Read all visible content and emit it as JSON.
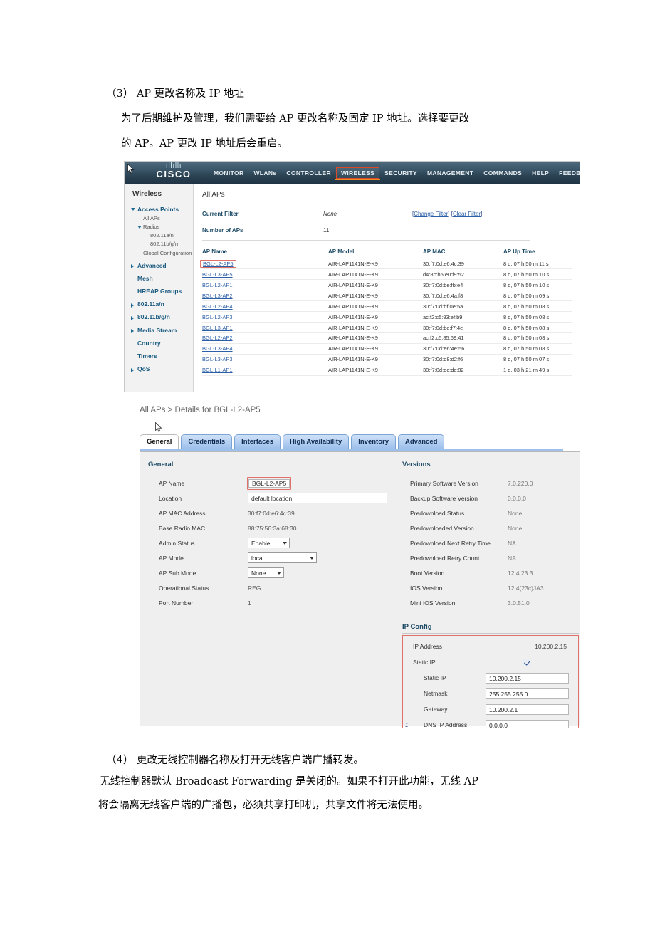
{
  "document": {
    "para3_heading": "（3） AP 更改名称及 IP 地址",
    "para3_line1": "为了后期维护及管理，我们需要给 AP 更改名称及固定 IP 地址。选择要更改",
    "para3_line2": "的 AP。AP 更改 IP 地址后会重启。",
    "para4_heading": "（4） 更改无线控制器名称及打开无线客户端广播转发。",
    "para4_line1": "无线控制器默认 Broadcast Forwarding  是关闭的。如果不打开此功能，无线 AP",
    "para4_line2": "将会隔离无线客户端的广播包，必须共享打印机，共享文件将无法使用。"
  },
  "wlc": {
    "brand": "CISCO",
    "brand_bars": "ıllıllı",
    "nav": [
      {
        "label": "MONITOR",
        "active": false
      },
      {
        "label": "WLANs",
        "active": false
      },
      {
        "label": "CONTROLLER",
        "active": false
      },
      {
        "label": "WIRELESS",
        "active": true
      },
      {
        "label": "SECURITY",
        "active": false
      },
      {
        "label": "MANAGEMENT",
        "active": false
      },
      {
        "label": "COMMANDS",
        "active": false
      },
      {
        "label": "HELP",
        "active": false
      },
      {
        "label": "FEEDBACK",
        "active": false
      }
    ],
    "sidebar": {
      "title": "Wireless",
      "items": [
        {
          "label": "Access Points",
          "level": 0,
          "bold": true,
          "arrow": "down"
        },
        {
          "label": "All APs",
          "level": 1,
          "bold": false,
          "arrow": "none"
        },
        {
          "label": "Radios",
          "level": 1,
          "bold": false,
          "arrow": "down"
        },
        {
          "label": "802.11a/n",
          "level": 2,
          "bold": false,
          "arrow": "none"
        },
        {
          "label": "802.11b/g/n",
          "level": 2,
          "bold": false,
          "arrow": "none"
        },
        {
          "label": "Global Configuration",
          "level": 1,
          "bold": false,
          "arrow": "none"
        },
        {
          "label": "Advanced",
          "level": 0,
          "bold": true,
          "arrow": "right"
        },
        {
          "label": "Mesh",
          "level": 0,
          "bold": true,
          "arrow": "none"
        },
        {
          "label": "HREAP Groups",
          "level": 0,
          "bold": true,
          "arrow": "none"
        },
        {
          "label": "802.11a/n",
          "level": 0,
          "bold": true,
          "arrow": "right"
        },
        {
          "label": "802.11b/g/n",
          "level": 0,
          "bold": true,
          "arrow": "right"
        },
        {
          "label": "Media Stream",
          "level": 0,
          "bold": true,
          "arrow": "right"
        },
        {
          "label": "Country",
          "level": 0,
          "bold": true,
          "arrow": "none"
        },
        {
          "label": "Timers",
          "level": 0,
          "bold": true,
          "arrow": "none"
        },
        {
          "label": "QoS",
          "level": 0,
          "bold": true,
          "arrow": "right"
        }
      ]
    },
    "page_title": "All APs",
    "current_filter_label": "Current Filter",
    "current_filter_value": "None",
    "change_filter_link": "Change Filter",
    "clear_filter_link": "Clear Filter",
    "number_of_aps_label": "Number of APs",
    "number_of_aps_value": "11",
    "table": {
      "headers": [
        "AP Name",
        "AP Model",
        "AP MAC",
        "AP Up Time"
      ],
      "rows": [
        {
          "name": "BGL-L2-AP5",
          "model": "AIR-LAP1141N-E-K9",
          "mac": "30:f7:0d:e6:4c:39",
          "uptime": "8 d, 07 h 50 m 11 s",
          "highlight": true
        },
        {
          "name": "BGL-L3-AP5",
          "model": "AIR-LAP1141N-E-K9",
          "mac": "d4:8c:b5:e0:f9:52",
          "uptime": "8 d, 07 h 50 m 10 s",
          "highlight": false
        },
        {
          "name": "BGL-L2-AP1",
          "model": "AIR-LAP1141N-E-K9",
          "mac": "30:f7:0d:be:fb:e4",
          "uptime": "8 d, 07 h 50 m 10 s",
          "highlight": false
        },
        {
          "name": "BGL-L3-AP2",
          "model": "AIR-LAP1141N-E-K9",
          "mac": "30:f7:0d:e6:4a:f8",
          "uptime": "8 d, 07 h 50 m 09 s",
          "highlight": false
        },
        {
          "name": "BGL-L2-AP4",
          "model": "AIR-LAP1141N-E-K9",
          "mac": "30:f7:0d:bf:0e:5a",
          "uptime": "8 d, 07 h 50 m 08 s",
          "highlight": false
        },
        {
          "name": "BGL-L2-AP3",
          "model": "AIR-LAP1141N-E-K9",
          "mac": "ac:f2:c5:93:ef:b9",
          "uptime": "8 d, 07 h 50 m 08 s",
          "highlight": false
        },
        {
          "name": "BGL-L3-AP1",
          "model": "AIR-LAP1141N-E-K9",
          "mac": "30:f7:0d:be:f7:4e",
          "uptime": "8 d, 07 h 50 m 08 s",
          "highlight": false
        },
        {
          "name": "BGL-L2-AP2",
          "model": "AIR-LAP1141N-E-K9",
          "mac": "ac:f2:c5:85:69:41",
          "uptime": "8 d, 07 h 50 m 08 s",
          "highlight": false
        },
        {
          "name": "BGL-L3-AP4",
          "model": "AIR-LAP1141N-E-K9",
          "mac": "30:f7:0d:e6:4e:56",
          "uptime": "8 d, 07 h 50 m 08 s",
          "highlight": false
        },
        {
          "name": "BGL-L3-AP3",
          "model": "AIR-LAP1141N-E-K9",
          "mac": "30:f7:0d:d8:d2:f6",
          "uptime": "8 d, 07 h 50 m 07 s",
          "highlight": false
        },
        {
          "name": "BGL-L1-AP1",
          "model": "AIR-LAP1141N-E-K9",
          "mac": "30:f7:0d:dc:dc:82",
          "uptime": "1 d, 03 h 21 m 49 s",
          "highlight": false
        }
      ]
    }
  },
  "details": {
    "breadcrumb": "All APs > Details for BGL-L2-AP5",
    "tabs": [
      {
        "label": "General",
        "active": true
      },
      {
        "label": "Credentials",
        "active": false
      },
      {
        "label": "Interfaces",
        "active": false
      },
      {
        "label": "High Availability",
        "active": false
      },
      {
        "label": "Inventory",
        "active": false
      },
      {
        "label": "Advanced",
        "active": false
      }
    ],
    "general": {
      "heading": "General",
      "ap_name_label": "AP Name",
      "ap_name_value": "BGL-L2-AP5",
      "location_label": "Location",
      "location_value": "default location",
      "ap_mac_label": "AP MAC Address",
      "ap_mac_value": "30:f7:0d:e6:4c:39",
      "base_radio_label": "Base Radio MAC",
      "base_radio_value": "88:75:56:3a:68:30",
      "admin_status_label": "Admin Status",
      "admin_status_value": "Enable",
      "ap_mode_label": "AP Mode",
      "ap_mode_value": "local",
      "ap_sub_mode_label": "AP Sub Mode",
      "ap_sub_mode_value": "None",
      "oper_status_label": "Operational Status",
      "oper_status_value": "REG",
      "port_number_label": "Port Number",
      "port_number_value": "1"
    },
    "versions": {
      "heading": "Versions",
      "rows": [
        {
          "label": "Primary Software Version",
          "value": "7.0.220.0"
        },
        {
          "label": "Backup Software Version",
          "value": "0.0.0.0"
        },
        {
          "label": "Predownload Status",
          "value": "None"
        },
        {
          "label": "Predownloaded Version",
          "value": "None"
        },
        {
          "label": "Predownload Next Retry Time",
          "value": "NA"
        },
        {
          "label": "Predownload Retry Count",
          "value": "NA"
        },
        {
          "label": "Boot Version",
          "value": "12.4.23.3"
        },
        {
          "label": "IOS Version",
          "value": "12.4(23c)JA3"
        },
        {
          "label": "Mini IOS Version",
          "value": "3.0.51.0"
        }
      ]
    },
    "ip_config": {
      "heading": "IP Config",
      "ip_address_label": "IP Address",
      "ip_address_value": "10.200.2.15",
      "static_ip_label": "Static IP",
      "static_ip_checked": true,
      "static_ip_field_label": "Static IP",
      "static_ip_field_value": "10.200.2.15",
      "netmask_label": "Netmask",
      "netmask_value": "255.255.255.0",
      "gateway_label": "Gateway",
      "gateway_value": "10.200.2.1",
      "dns_footnote": "1",
      "dns_label": "DNS IP Address",
      "dns_value": "0.0.0.0"
    }
  },
  "colors": {
    "highlight_red": "#e0716a",
    "link_blue": "#2b5fa8",
    "section_heading": "#1d4b66",
    "tab_blue": "#9dc0ec",
    "nav_active_orange": "#f08a22"
  }
}
